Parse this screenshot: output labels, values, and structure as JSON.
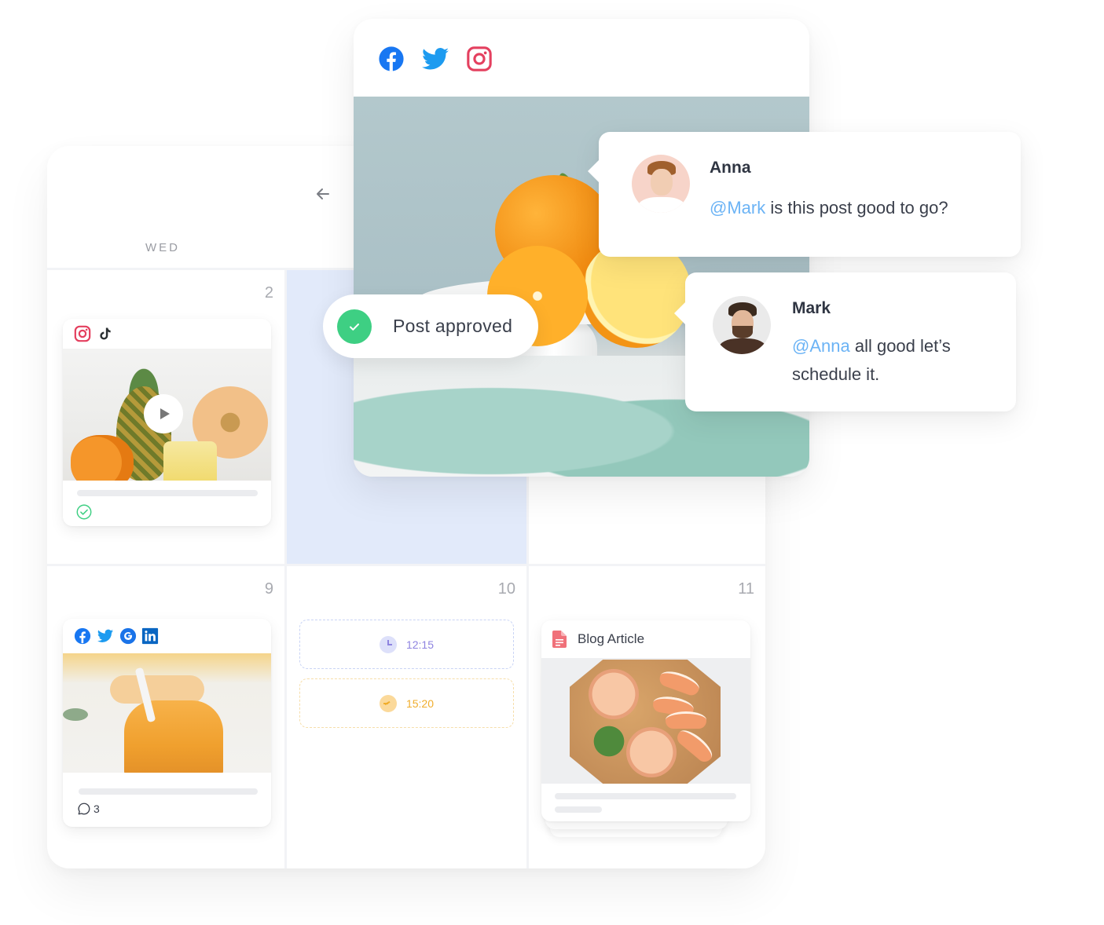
{
  "calendar": {
    "day_label": "WED",
    "back_icon": "arrow-left-icon",
    "cells": [
      {
        "date": "2"
      },
      {
        "date": ""
      },
      {
        "date": ""
      },
      {
        "date": "9"
      },
      {
        "date": "10"
      },
      {
        "date": "11"
      }
    ],
    "today_highlight_color": "#e2eafa"
  },
  "posts": {
    "video_post": {
      "networks": [
        "instagram-icon",
        "tiktok-icon"
      ],
      "media": "pineapple-smoothie-video",
      "play_icon": "play-icon",
      "status_icon": "approved-check-icon"
    },
    "smoothie_post": {
      "networks": [
        "facebook-icon",
        "twitter-icon",
        "google-icon",
        "linkedin-icon"
      ],
      "media": "mango-smoothie-photo",
      "comment_count": "3",
      "comment_icon": "comment-bubble-icon"
    },
    "blog_post": {
      "icon": "document-icon",
      "title": "Blog Article",
      "media": "grapefruit-drinks-photo"
    }
  },
  "time_slots": [
    {
      "time": "12:15",
      "color": "#8e83e0"
    },
    {
      "time": "15:20",
      "color": "#f0ad2c"
    }
  ],
  "social_post": {
    "networks": [
      "facebook-icon",
      "twitter-icon",
      "instagram-icon"
    ],
    "media": "oranges-on-cake-stand-photo"
  },
  "approval": {
    "label": "Post approved",
    "icon": "check-icon",
    "color": "#3ecf83"
  },
  "comments": [
    {
      "author": "Anna",
      "mention": "@Mark",
      "text": " is this post good to go?"
    },
    {
      "author": "Mark",
      "mention": "@Anna",
      "text": " all good let’s schedule it."
    }
  ],
  "colors": {
    "facebook": "#1877f2",
    "twitter": "#1d9bf0",
    "instagram": "#e4405f",
    "linkedin": "#0a66c2",
    "mention": "#6bb3f5"
  }
}
